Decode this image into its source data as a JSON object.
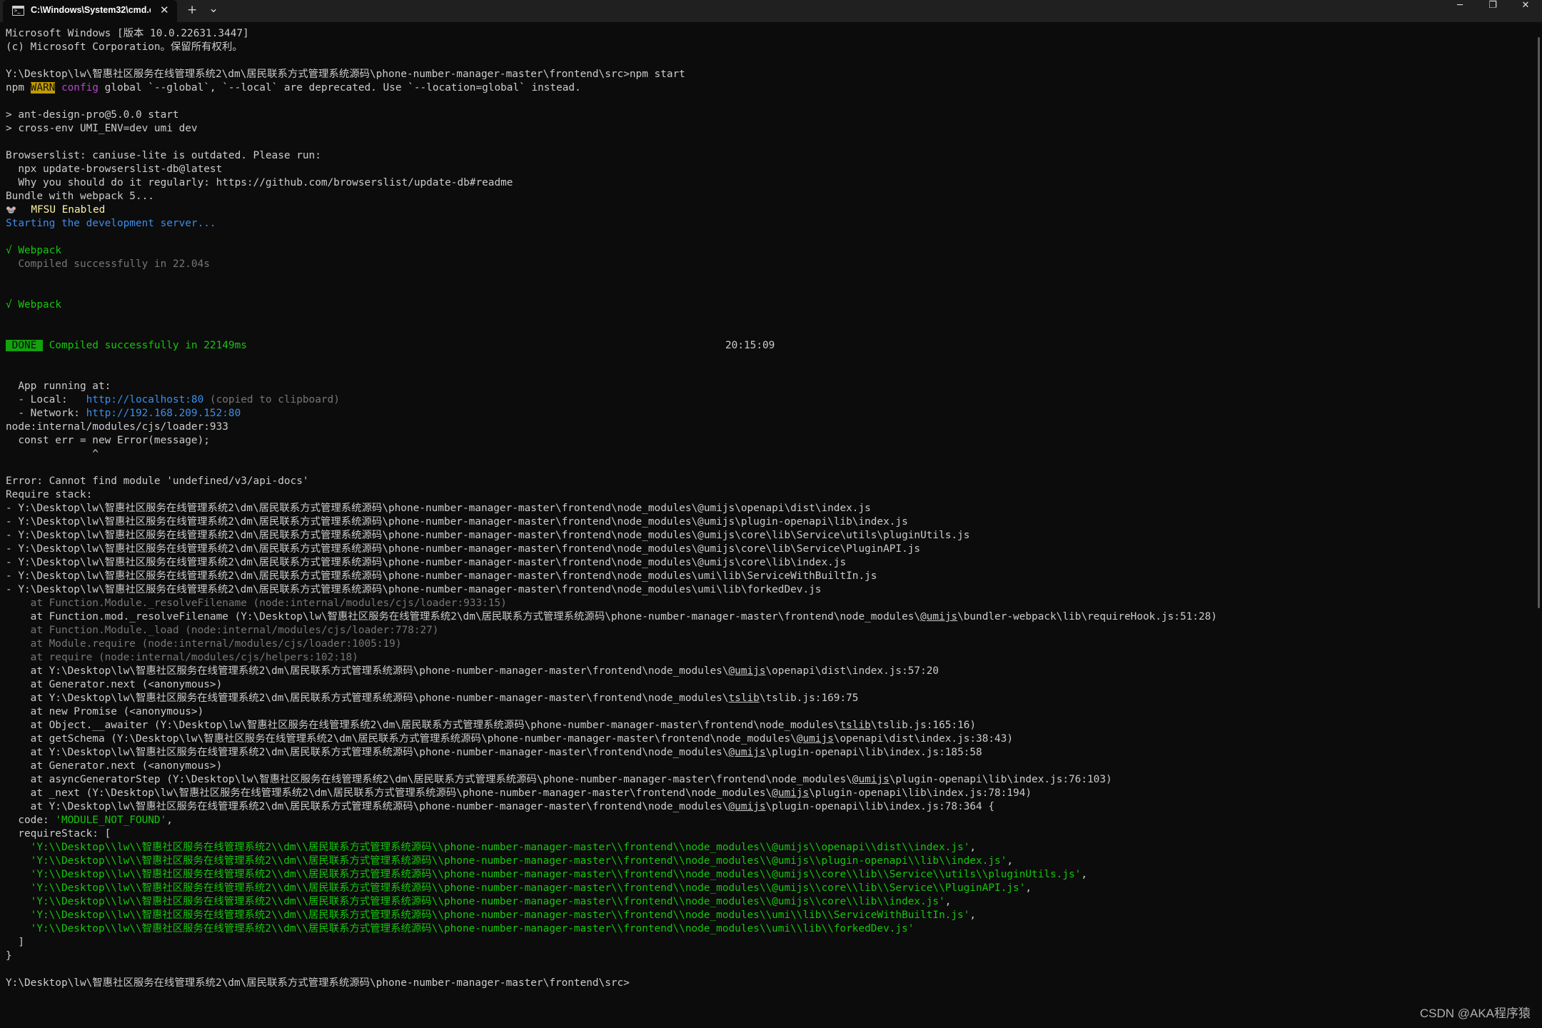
{
  "titlebar": {
    "tab_title": "C:\\Windows\\System32\\cmd.e",
    "tab_close": "✕",
    "new_tab": "+",
    "dropdown": "⌄",
    "minimize": "─",
    "maximize": "❐",
    "close": "✕"
  },
  "terminal": {
    "l1": "Microsoft Windows [版本 10.0.22631.3447]",
    "l2": "(c) Microsoft Corporation。保留所有权利。",
    "l3": "Y:\\Desktop\\lw\\智惠社区服务在线管理系统2\\dm\\居民联系方式管理系统源码\\phone-number-manager-master\\frontend\\src>npm start",
    "l4_npm": "npm ",
    "l4_warn": "WARN",
    "l4_config": " config",
    "l4_rest": " global `--global`, `--local` are deprecated. Use `--location=global` instead.",
    "l5": "> ant-design-pro@5.0.0 start",
    "l6": "> cross-env UMI_ENV=dev umi dev",
    "l7": "Browserslist: caniuse-lite is outdated. Please run:",
    "l8": "  npx update-browserslist-db@latest",
    "l9": "  Why you should do it regularly: https://github.com/browserslist/update-db#readme",
    "l10": "Bundle with webpack 5...",
    "l11_icon": "🐭",
    "l11": "MFSU Enabled",
    "l12": "Starting the development server...",
    "l13_check": "√",
    "l13": " Webpack",
    "l14": "  Compiled successfully in 22.04s",
    "l15_check": "√",
    "l15": " Webpack",
    "l16_done": " DONE ",
    "l16": " Compiled successfully in 22149ms",
    "l16_time": "20:15:09",
    "l17": "  App running at:",
    "l18_pre": "  - Local:   ",
    "l18_url": "http://localhost:80",
    "l18_post": " (copied to clipboard)",
    "l19_pre": "  - Network: ",
    "l19_url": "http://192.168.209.152:80",
    "l20": "node:internal/modules/cjs/loader:933",
    "l21": "  const err = new Error(message);",
    "l22": "              ^",
    "l23": "Error: Cannot find module 'undefined/v3/api-docs'",
    "l24": "Require stack:",
    "l25": "- Y:\\Desktop\\lw\\智惠社区服务在线管理系统2\\dm\\居民联系方式管理系统源码\\phone-number-manager-master\\frontend\\node_modules\\@umijs\\openapi\\dist\\index.js",
    "l26": "- Y:\\Desktop\\lw\\智惠社区服务在线管理系统2\\dm\\居民联系方式管理系统源码\\phone-number-manager-master\\frontend\\node_modules\\@umijs\\plugin-openapi\\lib\\index.js",
    "l27": "- Y:\\Desktop\\lw\\智惠社区服务在线管理系统2\\dm\\居民联系方式管理系统源码\\phone-number-manager-master\\frontend\\node_modules\\@umijs\\core\\lib\\Service\\utils\\pluginUtils.js",
    "l28": "- Y:\\Desktop\\lw\\智惠社区服务在线管理系统2\\dm\\居民联系方式管理系统源码\\phone-number-manager-master\\frontend\\node_modules\\@umijs\\core\\lib\\Service\\PluginAPI.js",
    "l29": "- Y:\\Desktop\\lw\\智惠社区服务在线管理系统2\\dm\\居民联系方式管理系统源码\\phone-number-manager-master\\frontend\\node_modules\\@umijs\\core\\lib\\index.js",
    "l30": "- Y:\\Desktop\\lw\\智惠社区服务在线管理系统2\\dm\\居民联系方式管理系统源码\\phone-number-manager-master\\frontend\\node_modules\\umi\\lib\\ServiceWithBuiltIn.js",
    "l31": "- Y:\\Desktop\\lw\\智惠社区服务在线管理系统2\\dm\\居民联系方式管理系统源码\\phone-number-manager-master\\frontend\\node_modules\\umi\\lib\\forkedDev.js",
    "l32": "    at Function.Module._resolveFilename (node:internal/modules/cjs/loader:933:15)",
    "l33_a": "    at Function.mod._resolveFilename (Y:\\Desktop\\lw\\智惠社区服务在线管理系统2\\dm\\居民联系方式管理系统源码\\phone-number-manager-master\\frontend\\node_modules\\",
    "l33_u": "@umijs",
    "l33_b": "\\bundler-webpack\\lib\\requireHook.js:51:28)",
    "l34": "    at Function.Module._load (node:internal/modules/cjs/loader:778:27)",
    "l35": "    at Module.require (node:internal/modules/cjs/loader:1005:19)",
    "l36": "    at require (node:internal/modules/cjs/helpers:102:18)",
    "l37_a": "    at Y:\\Desktop\\lw\\智惠社区服务在线管理系统2\\dm\\居民联系方式管理系统源码\\phone-number-manager-master\\frontend\\node_modules\\",
    "l37_u": "@umijs",
    "l37_b": "\\openapi\\dist\\index.js:57:20",
    "l38": "    at Generator.next (<anonymous>)",
    "l39_a": "    at Y:\\Desktop\\lw\\智惠社区服务在线管理系统2\\dm\\居民联系方式管理系统源码\\phone-number-manager-master\\frontend\\node_modules\\",
    "l39_u": "tslib",
    "l39_b": "\\tslib.js:169:75",
    "l40": "    at new Promise (<anonymous>)",
    "l41_a": "    at Object.__awaiter (Y:\\Desktop\\lw\\智惠社区服务在线管理系统2\\dm\\居民联系方式管理系统源码\\phone-number-manager-master\\frontend\\node_modules\\",
    "l41_u": "tslib",
    "l41_b": "\\tslib.js:165:16)",
    "l42_a": "    at getSchema (Y:\\Desktop\\lw\\智惠社区服务在线管理系统2\\dm\\居民联系方式管理系统源码\\phone-number-manager-master\\frontend\\node_modules\\",
    "l42_u": "@umijs",
    "l42_b": "\\openapi\\dist\\index.js:38:43)",
    "l43_a": "    at Y:\\Desktop\\lw\\智惠社区服务在线管理系统2\\dm\\居民联系方式管理系统源码\\phone-number-manager-master\\frontend\\node_modules\\",
    "l43_u": "@umijs",
    "l43_b": "\\plugin-openapi\\lib\\index.js:185:58",
    "l44": "    at Generator.next (<anonymous>)",
    "l45_a": "    at asyncGeneratorStep (Y:\\Desktop\\lw\\智惠社区服务在线管理系统2\\dm\\居民联系方式管理系统源码\\phone-number-manager-master\\frontend\\node_modules\\",
    "l45_u": "@umijs",
    "l45_b": "\\plugin-openapi\\lib\\index.js:76:103)",
    "l46_a": "    at _next (Y:\\Desktop\\lw\\智惠社区服务在线管理系统2\\dm\\居民联系方式管理系统源码\\phone-number-manager-master\\frontend\\node_modules\\",
    "l46_u": "@umijs",
    "l46_b": "\\plugin-openapi\\lib\\index.js:78:194)",
    "l47_a": "    at Y:\\Desktop\\lw\\智惠社区服务在线管理系统2\\dm\\居民联系方式管理系统源码\\phone-number-manager-master\\frontend\\node_modules\\",
    "l47_u": "@umijs",
    "l47_b": "\\plugin-openapi\\lib\\index.js:78:364 {",
    "l48_a": "  code: ",
    "l48_s": "'MODULE_NOT_FOUND'",
    "l48_b": ",",
    "l49": "  requireStack: [",
    "l50": "    'Y:\\\\Desktop\\\\lw\\\\智惠社区服务在线管理系统2\\\\dm\\\\居民联系方式管理系统源码\\\\phone-number-manager-master\\\\frontend\\\\node_modules\\\\@umijs\\\\openapi\\\\dist\\\\index.js'",
    "l51": "    'Y:\\\\Desktop\\\\lw\\\\智惠社区服务在线管理系统2\\\\dm\\\\居民联系方式管理系统源码\\\\phone-number-manager-master\\\\frontend\\\\node_modules\\\\@umijs\\\\plugin-openapi\\\\lib\\\\index.js'",
    "l52": "    'Y:\\\\Desktop\\\\lw\\\\智惠社区服务在线管理系统2\\\\dm\\\\居民联系方式管理系统源码\\\\phone-number-manager-master\\\\frontend\\\\node_modules\\\\@umijs\\\\core\\\\lib\\\\Service\\\\utils\\\\pluginUtils.js'",
    "l53": "    'Y:\\\\Desktop\\\\lw\\\\智惠社区服务在线管理系统2\\\\dm\\\\居民联系方式管理系统源码\\\\phone-number-manager-master\\\\frontend\\\\node_modules\\\\@umijs\\\\core\\\\lib\\\\Service\\\\PluginAPI.js'",
    "l54": "    'Y:\\\\Desktop\\\\lw\\\\智惠社区服务在线管理系统2\\\\dm\\\\居民联系方式管理系统源码\\\\phone-number-manager-master\\\\frontend\\\\node_modules\\\\@umijs\\\\core\\\\lib\\\\index.js'",
    "l55": "    'Y:\\\\Desktop\\\\lw\\\\智惠社区服务在线管理系统2\\\\dm\\\\居民联系方式管理系统源码\\\\phone-number-manager-master\\\\frontend\\\\node_modules\\\\umi\\\\lib\\\\ServiceWithBuiltIn.js'",
    "l56": "    'Y:\\\\Desktop\\\\lw\\\\智惠社区服务在线管理系统2\\\\dm\\\\居民联系方式管理系统源码\\\\phone-number-manager-master\\\\frontend\\\\node_modules\\\\umi\\\\lib\\\\forkedDev.js'",
    "comma": ",",
    "l57": "  ]",
    "l58": "}",
    "l59": "Y:\\Desktop\\lw\\智惠社区服务在线管理系统2\\dm\\居民联系方式管理系统源码\\phone-number-manager-master\\frontend\\src>"
  },
  "watermark": "CSDN @AKA程序猿",
  "colors": {
    "background": "#0c0c0c",
    "text": "#cccccc",
    "warn": "#c19c00",
    "magenta": "#b148c6",
    "blue": "#3b8eea",
    "green": "#16c60c",
    "done_bg": "#13a10e"
  }
}
